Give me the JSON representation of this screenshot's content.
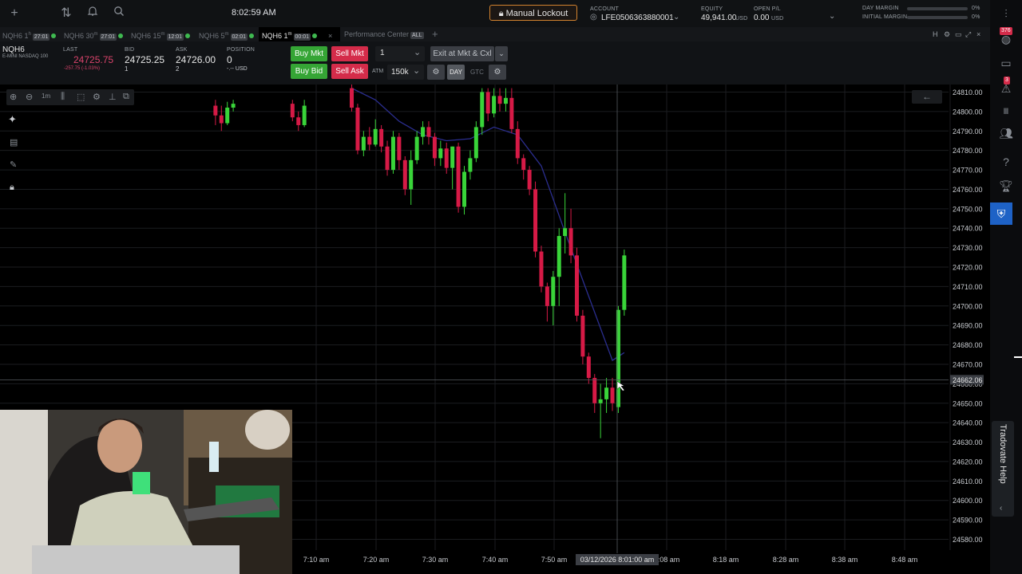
{
  "header": {
    "clock": "8:02:59 AM",
    "lockout_label": "Manual Lockout",
    "account_label": "ACCOUNT",
    "account_id": "LFE0506363880001",
    "equity_label": "EQUITY",
    "equity_value": "49,941.00",
    "equity_unit": "USD",
    "open_pl_label": "OPEN P/L",
    "open_pl_value": "0.00",
    "open_pl_unit": "USD",
    "day_margin_label": "DAY MARGIN",
    "day_margin_value": "0%",
    "initial_margin_label": "INITIAL MARGIN",
    "initial_margin_value": "0%"
  },
  "tabs": [
    {
      "label": "NQH6 1",
      "sup": "h",
      "badge": "27:01"
    },
    {
      "label": "NQH6 30",
      "sup": "m",
      "badge": "27:01"
    },
    {
      "label": "NQH6 15",
      "sup": "m",
      "badge": "12:01"
    },
    {
      "label": "NQH6 5",
      "sup": "m",
      "badge": "02:01"
    },
    {
      "label": "NQH6 1",
      "sup": "m",
      "badge": "00:01"
    },
    {
      "label": "Performance Center",
      "sup": "",
      "badge": "ALL"
    }
  ],
  "quote": {
    "symbol": "NQH6",
    "description": "E-MINI NASDAQ 100",
    "last_label": "LAST",
    "last_value": "24725.75",
    "last_change": "-257.75 (-1.03%)",
    "bid_label": "BID",
    "bid_value": "24725.25",
    "bid_size": "1",
    "ask_label": "ASK",
    "ask_value": "24726.00",
    "ask_size": "2",
    "position_label": "POSITION",
    "position_value": "0",
    "position_usd": "-.-- USD"
  },
  "order": {
    "buy_mkt": "Buy Mkt",
    "sell_mkt": "Sell Mkt",
    "buy_bid": "Buy Bid",
    "sell_ask": "Sell Ask",
    "qty": "1",
    "exit_label": "Exit at Mkt & Cxl",
    "atm_label": "ATM",
    "atm_value": "150k",
    "day_label": "DAY",
    "gtc_label": "GTC"
  },
  "sidebar": {
    "badge_top": "376",
    "badge_alert": "3",
    "help_label": "Tradovate Help"
  },
  "chart": {
    "interval_label": "1m",
    "crosshair_price": "24662.06",
    "crosshair_time": "03/12/2026 8:01:00 am",
    "colors": {
      "up": "#39d439",
      "down": "#d61a46",
      "ma": "#2b2e8f",
      "grid": "#1b1d20"
    }
  },
  "chart_data": {
    "type": "candlestick",
    "ylim": [
      24575,
      24815
    ],
    "y_ticks": [
      24580,
      24590,
      24600,
      24610,
      24620,
      24630,
      24640,
      24650,
      24660,
      24670,
      24680,
      24690,
      24700,
      24710,
      24720,
      24730,
      24740,
      24750,
      24760,
      24770,
      24780,
      24790,
      24800,
      24810
    ],
    "x_ticks": [
      "7:10 am",
      "7:20 am",
      "7:30 am",
      "7:40 am",
      "7:50 am",
      "8:08 am",
      "8:18 am",
      "8:28 am",
      "8:38 am",
      "8:48 am"
    ],
    "candles": [
      {
        "t": "6:53",
        "o": 24803,
        "h": 24806,
        "l": 24793,
        "c": 24798
      },
      {
        "t": "6:54",
        "o": 24798,
        "h": 24803,
        "l": 24790,
        "c": 24794
      },
      {
        "t": "6:55",
        "o": 24794,
        "h": 24805,
        "l": 24793,
        "c": 24802
      },
      {
        "t": "6:56",
        "o": 24802,
        "h": 24806,
        "l": 24800,
        "c": 24804
      },
      {
        "t": "7:06",
        "o": 24804,
        "h": 24806,
        "l": 24795,
        "c": 24797
      },
      {
        "t": "7:07",
        "o": 24797,
        "h": 24800,
        "l": 24790,
        "c": 24793
      },
      {
        "t": "7:08",
        "o": 24793,
        "h": 24806,
        "l": 24792,
        "c": 24803
      },
      {
        "t": "7:16",
        "o": 24812,
        "h": 24815,
        "l": 24800,
        "c": 24802
      },
      {
        "t": "7:17",
        "o": 24802,
        "h": 24804,
        "l": 24778,
        "c": 24780
      },
      {
        "t": "7:18",
        "o": 24780,
        "h": 24790,
        "l": 24777,
        "c": 24787
      },
      {
        "t": "7:19",
        "o": 24787,
        "h": 24792,
        "l": 24780,
        "c": 24783
      },
      {
        "t": "7:20",
        "o": 24783,
        "h": 24796,
        "l": 24782,
        "c": 24791
      },
      {
        "t": "7:21",
        "o": 24791,
        "h": 24793,
        "l": 24779,
        "c": 24782
      },
      {
        "t": "7:22",
        "o": 24782,
        "h": 24785,
        "l": 24767,
        "c": 24770
      },
      {
        "t": "7:23",
        "o": 24770,
        "h": 24790,
        "l": 24768,
        "c": 24787
      },
      {
        "t": "7:24",
        "o": 24787,
        "h": 24789,
        "l": 24770,
        "c": 24775
      },
      {
        "t": "7:25",
        "o": 24775,
        "h": 24777,
        "l": 24757,
        "c": 24760
      },
      {
        "t": "7:26",
        "o": 24760,
        "h": 24780,
        "l": 24752,
        "c": 24775
      },
      {
        "t": "7:27",
        "o": 24775,
        "h": 24790,
        "l": 24773,
        "c": 24787
      },
      {
        "t": "7:28",
        "o": 24787,
        "h": 24795,
        "l": 24783,
        "c": 24792
      },
      {
        "t": "7:29",
        "o": 24792,
        "h": 24795,
        "l": 24783,
        "c": 24787
      },
      {
        "t": "7:30",
        "o": 24787,
        "h": 24789,
        "l": 24772,
        "c": 24776
      },
      {
        "t": "7:31",
        "o": 24776,
        "h": 24785,
        "l": 24772,
        "c": 24781
      },
      {
        "t": "7:32",
        "o": 24781,
        "h": 24784,
        "l": 24768,
        "c": 24771
      },
      {
        "t": "7:33",
        "o": 24771,
        "h": 24782,
        "l": 24760,
        "c": 24782
      },
      {
        "t": "7:34",
        "o": 24782,
        "h": 24784,
        "l": 24748,
        "c": 24751
      },
      {
        "t": "7:35",
        "o": 24751,
        "h": 24772,
        "l": 24747,
        "c": 24769
      },
      {
        "t": "7:36",
        "o": 24769,
        "h": 24780,
        "l": 24765,
        "c": 24776
      },
      {
        "t": "7:37",
        "o": 24776,
        "h": 24795,
        "l": 24774,
        "c": 24792
      },
      {
        "t": "7:38",
        "o": 24792,
        "h": 24812,
        "l": 24788,
        "c": 24810
      },
      {
        "t": "7:39",
        "o": 24810,
        "h": 24812,
        "l": 24795,
        "c": 24799
      },
      {
        "t": "7:40",
        "o": 24799,
        "h": 24812,
        "l": 24797,
        "c": 24808
      },
      {
        "t": "7:41",
        "o": 24808,
        "h": 24812,
        "l": 24800,
        "c": 24804
      },
      {
        "t": "7:42",
        "o": 24804,
        "h": 24812,
        "l": 24800,
        "c": 24807
      },
      {
        "t": "7:43",
        "o": 24807,
        "h": 24812,
        "l": 24789,
        "c": 24791
      },
      {
        "t": "7:44",
        "o": 24791,
        "h": 24795,
        "l": 24773,
        "c": 24776
      },
      {
        "t": "7:45",
        "o": 24776,
        "h": 24778,
        "l": 24765,
        "c": 24770
      },
      {
        "t": "7:46",
        "o": 24770,
        "h": 24772,
        "l": 24757,
        "c": 24760
      },
      {
        "t": "7:47",
        "o": 24760,
        "h": 24764,
        "l": 24725,
        "c": 24728
      },
      {
        "t": "7:48",
        "o": 24728,
        "h": 24731,
        "l": 24707,
        "c": 24710
      },
      {
        "t": "7:49",
        "o": 24710,
        "h": 24712,
        "l": 24692,
        "c": 24700
      },
      {
        "t": "7:50",
        "o": 24700,
        "h": 24718,
        "l": 24690,
        "c": 24715
      },
      {
        "t": "7:51",
        "o": 24715,
        "h": 24740,
        "l": 24700,
        "c": 24736
      },
      {
        "t": "7:52",
        "o": 24736,
        "h": 24758,
        "l": 24727,
        "c": 24740
      },
      {
        "t": "7:53",
        "o": 24740,
        "h": 24750,
        "l": 24722,
        "c": 24726
      },
      {
        "t": "7:54",
        "o": 24726,
        "h": 24730,
        "l": 24692,
        "c": 24695
      },
      {
        "t": "7:55",
        "o": 24695,
        "h": 24698,
        "l": 24670,
        "c": 24674
      },
      {
        "t": "7:56",
        "o": 24674,
        "h": 24676,
        "l": 24660,
        "c": 24663
      },
      {
        "t": "7:57",
        "o": 24663,
        "h": 24665,
        "l": 24645,
        "c": 24650
      },
      {
        "t": "7:58",
        "o": 24650,
        "h": 24660,
        "l": 24632,
        "c": 24652
      },
      {
        "t": "7:59",
        "o": 24652,
        "h": 24663,
        "l": 24645,
        "c": 24658
      },
      {
        "t": "8:00",
        "o": 24658,
        "h": 24663,
        "l": 24646,
        "c": 24650
      },
      {
        "t": "8:01",
        "o": 24648,
        "h": 24700,
        "l": 24645,
        "c": 24698
      },
      {
        "t": "8:02",
        "o": 24698,
        "h": 24729,
        "l": 24695,
        "c": 24726
      }
    ],
    "ma": [
      [
        "7:16",
        24812
      ],
      [
        "7:20",
        24806
      ],
      [
        "7:24",
        24795
      ],
      [
        "7:28",
        24788
      ],
      [
        "7:32",
        24785
      ],
      [
        "7:36",
        24786
      ],
      [
        "7:40",
        24792
      ],
      [
        "7:44",
        24788
      ],
      [
        "7:48",
        24772
      ],
      [
        "7:52",
        24738
      ],
      [
        "7:56",
        24705
      ],
      [
        "8:00",
        24672
      ],
      [
        "8:02",
        24676
      ]
    ]
  }
}
